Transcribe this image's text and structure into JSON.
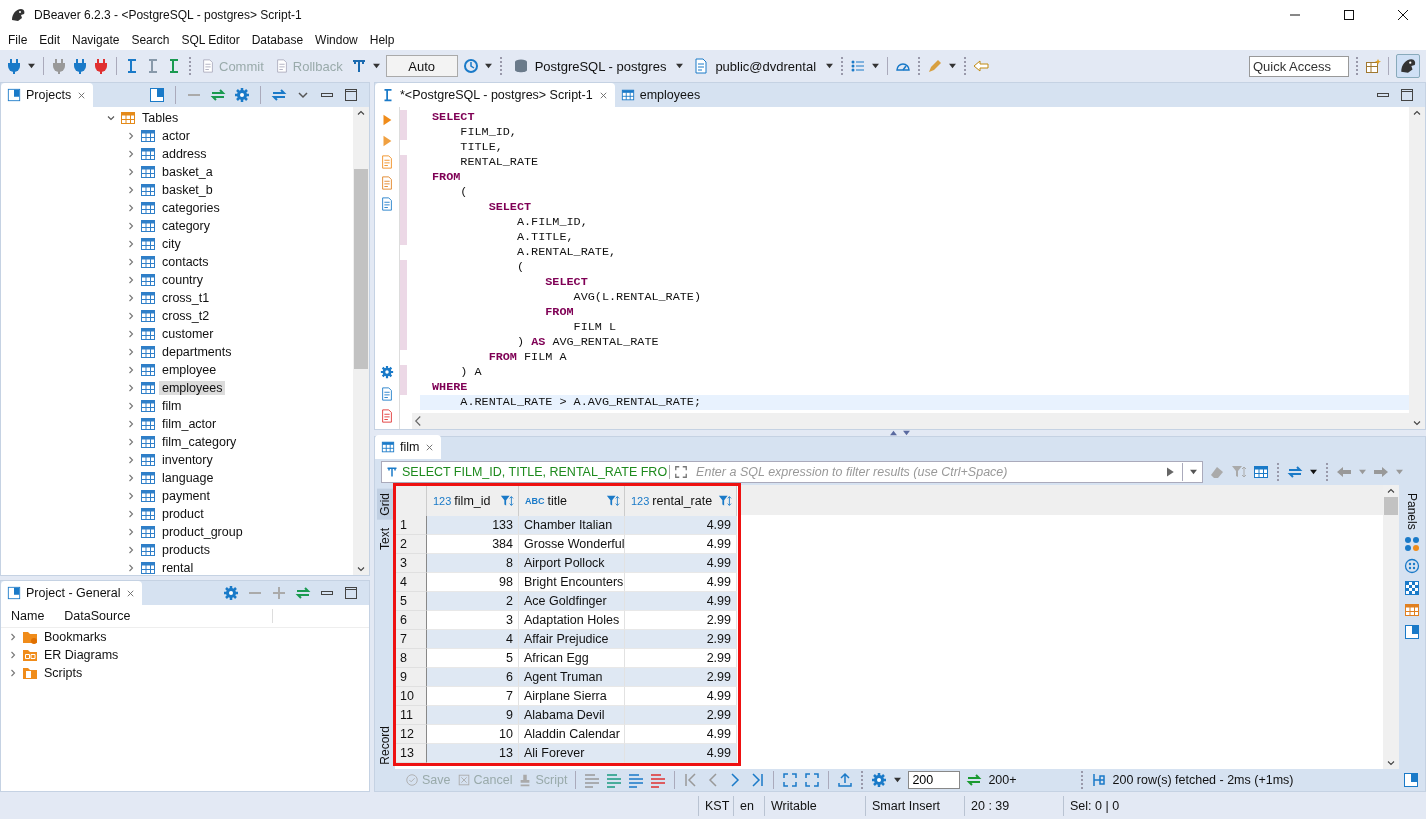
{
  "window": {
    "title": "DBeaver 6.2.3 - <PostgreSQL - postgres> Script-1"
  },
  "menu": [
    "File",
    "Edit",
    "Navigate",
    "Search",
    "SQL Editor",
    "Database",
    "Window",
    "Help"
  ],
  "toolbar": {
    "commit": {
      "label": "Commit",
      "disabled": true
    },
    "rollback": {
      "label": "Rollback",
      "disabled": true
    },
    "mode": "Auto",
    "connection": "PostgreSQL - postgres",
    "schema": "public@dvdrental",
    "quick_access": {
      "placeholder": "Quick Access"
    }
  },
  "projects": {
    "title": "Projects",
    "tree": [
      {
        "label": "Tables",
        "expanded": true,
        "selected": false,
        "children": [
          {
            "label": "actor",
            "expanded": false,
            "selected": false
          },
          {
            "label": "address",
            "expanded": false,
            "selected": false
          },
          {
            "label": "basket_a",
            "expanded": false,
            "selected": false
          },
          {
            "label": "basket_b",
            "expanded": false,
            "selected": false
          },
          {
            "label": "categories",
            "expanded": false,
            "selected": false
          },
          {
            "label": "category",
            "expanded": false,
            "selected": false
          },
          {
            "label": "city",
            "expanded": false,
            "selected": false
          },
          {
            "label": "contacts",
            "expanded": false,
            "selected": false
          },
          {
            "label": "country",
            "expanded": false,
            "selected": false
          },
          {
            "label": "cross_t1",
            "expanded": false,
            "selected": false
          },
          {
            "label": "cross_t2",
            "expanded": false,
            "selected": false
          },
          {
            "label": "customer",
            "expanded": false,
            "selected": false
          },
          {
            "label": "departments",
            "expanded": false,
            "selected": false
          },
          {
            "label": "employee",
            "expanded": false,
            "selected": false
          },
          {
            "label": "employees",
            "expanded": false,
            "selected": true
          },
          {
            "label": "film",
            "expanded": false,
            "selected": false
          },
          {
            "label": "film_actor",
            "expanded": false,
            "selected": false
          },
          {
            "label": "film_category",
            "expanded": false,
            "selected": false
          },
          {
            "label": "inventory",
            "expanded": false,
            "selected": false
          },
          {
            "label": "language",
            "expanded": false,
            "selected": false
          },
          {
            "label": "payment",
            "expanded": false,
            "selected": false
          },
          {
            "label": "product",
            "expanded": false,
            "selected": false
          },
          {
            "label": "product_group",
            "expanded": false,
            "selected": false
          },
          {
            "label": "products",
            "expanded": false,
            "selected": false
          },
          {
            "label": "rental",
            "expanded": false,
            "selected": false
          }
        ]
      }
    ]
  },
  "project_general": {
    "title": "Project - General",
    "columns": [
      "Name",
      "DataSource"
    ],
    "items": [
      {
        "label": "Bookmarks",
        "kind": "bookmarks",
        "expanded": false
      },
      {
        "label": "ER Diagrams",
        "kind": "diagrams",
        "expanded": false
      },
      {
        "label": "Scripts",
        "kind": "scripts",
        "expanded": false
      }
    ]
  },
  "editor_tabs": [
    {
      "label": "*<PostgreSQL - postgres> Script-1",
      "kind": "script",
      "selected": true
    },
    {
      "label": "employees",
      "kind": "table",
      "selected": false
    }
  ],
  "code": [
    {
      "current": false,
      "parts": [
        {
          "kind": "keyword",
          "text": "SELECT"
        }
      ]
    },
    {
      "current": false,
      "parts": [
        {
          "kind": "plain",
          "text": "    FILM_ID,"
        }
      ]
    },
    {
      "current": false,
      "parts": [
        {
          "kind": "plain",
          "text": "    TITLE,"
        }
      ]
    },
    {
      "current": false,
      "parts": [
        {
          "kind": "plain",
          "text": "    RENTAL_RATE"
        }
      ]
    },
    {
      "current": false,
      "parts": [
        {
          "kind": "keyword",
          "text": "FROM"
        }
      ]
    },
    {
      "current": false,
      "parts": [
        {
          "kind": "plain",
          "text": "    ("
        }
      ]
    },
    {
      "current": false,
      "parts": [
        {
          "kind": "keyword",
          "text": "        SELECT"
        }
      ]
    },
    {
      "current": false,
      "parts": [
        {
          "kind": "plain",
          "text": "            A.FILM_ID,"
        }
      ]
    },
    {
      "current": false,
      "parts": [
        {
          "kind": "plain",
          "text": "            A.TITLE,"
        }
      ]
    },
    {
      "current": false,
      "parts": [
        {
          "kind": "plain",
          "text": "            A.RENTAL_RATE,"
        }
      ]
    },
    {
      "current": false,
      "parts": [
        {
          "kind": "plain",
          "text": "            ("
        }
      ]
    },
    {
      "current": false,
      "parts": [
        {
          "kind": "keyword",
          "text": "                SELECT"
        }
      ]
    },
    {
      "current": false,
      "parts": [
        {
          "kind": "plain",
          "text": "                    AVG(L.RENTAL_RATE)"
        }
      ]
    },
    {
      "current": false,
      "parts": [
        {
          "kind": "keyword",
          "text": "                FROM"
        }
      ]
    },
    {
      "current": false,
      "parts": [
        {
          "kind": "plain",
          "text": "                    FILM L"
        }
      ]
    },
    {
      "current": false,
      "parts": [
        {
          "kind": "plain",
          "text": "            ) "
        },
        {
          "kind": "keyword",
          "text": "AS"
        },
        {
          "kind": "plain",
          "text": " AVG_RENTAL_RATE"
        }
      ]
    },
    {
      "current": false,
      "parts": [
        {
          "kind": "keyword",
          "text": "        FROM"
        },
        {
          "kind": "plain",
          "text": " FILM A"
        }
      ]
    },
    {
      "current": false,
      "parts": [
        {
          "kind": "plain",
          "text": "    ) A"
        }
      ]
    },
    {
      "current": false,
      "parts": [
        {
          "kind": "keyword",
          "text": "WHERE"
        }
      ]
    },
    {
      "current": true,
      "parts": [
        {
          "kind": "plain",
          "text": "    A.RENTAL_RATE > A.AVG_RENTAL_RATE;"
        }
      ]
    }
  ],
  "results": {
    "tab": "film",
    "query": "SELECT FILM_ID, TITLE, RENTAL_RATE FRO",
    "filter": {
      "placeholder": "Enter a SQL expression to filter results (use Ctrl+Space)"
    },
    "views": [
      {
        "label": "Grid",
        "selected": true
      },
      {
        "label": "Text",
        "selected": false
      },
      {
        "label": "Record",
        "selected": false
      }
    ],
    "columns": [
      {
        "type": "123",
        "name": "film_id",
        "kind": "number"
      },
      {
        "type": "ABC",
        "name": "title",
        "kind": "text"
      },
      {
        "type": "123",
        "name": "rental_rate",
        "kind": "number"
      }
    ],
    "rows": [
      {
        "number": "1",
        "cells": [
          "133",
          "Chamber Italian",
          "4.99"
        ]
      },
      {
        "number": "2",
        "cells": [
          "384",
          "Grosse Wonderful",
          "4.99"
        ]
      },
      {
        "number": "3",
        "cells": [
          "8",
          "Airport Pollock",
          "4.99"
        ]
      },
      {
        "number": "4",
        "cells": [
          "98",
          "Bright Encounters",
          "4.99"
        ]
      },
      {
        "number": "5",
        "cells": [
          "2",
          "Ace Goldfinger",
          "4.99"
        ]
      },
      {
        "number": "6",
        "cells": [
          "3",
          "Adaptation Holes",
          "2.99"
        ]
      },
      {
        "number": "7",
        "cells": [
          "4",
          "Affair Prejudice",
          "2.99"
        ]
      },
      {
        "number": "8",
        "cells": [
          "5",
          "African Egg",
          "2.99"
        ]
      },
      {
        "number": "9",
        "cells": [
          "6",
          "Agent Truman",
          "2.99"
        ]
      },
      {
        "number": "10",
        "cells": [
          "7",
          "Airplane Sierra",
          "4.99"
        ]
      },
      {
        "number": "11",
        "cells": [
          "9",
          "Alabama Devil",
          "2.99"
        ]
      },
      {
        "number": "12",
        "cells": [
          "10",
          "Aladdin Calendar",
          "4.99"
        ]
      },
      {
        "number": "13",
        "cells": [
          "13",
          "Ali Forever",
          "4.99"
        ]
      }
    ],
    "panels": "Panels",
    "actions": [
      {
        "label": "Save",
        "disabled": true
      },
      {
        "label": "Cancel",
        "disabled": true
      },
      {
        "label": "Script",
        "disabled": true
      }
    ],
    "page_size": "200",
    "fetch_more": "200+",
    "fetch_status": "200 row(s) fetched - 2ms (+1ms)"
  },
  "status_bar": [
    "KST",
    "en",
    "Writable",
    "Smart Insert",
    "20 : 39",
    "Sel: 0 | 0"
  ]
}
